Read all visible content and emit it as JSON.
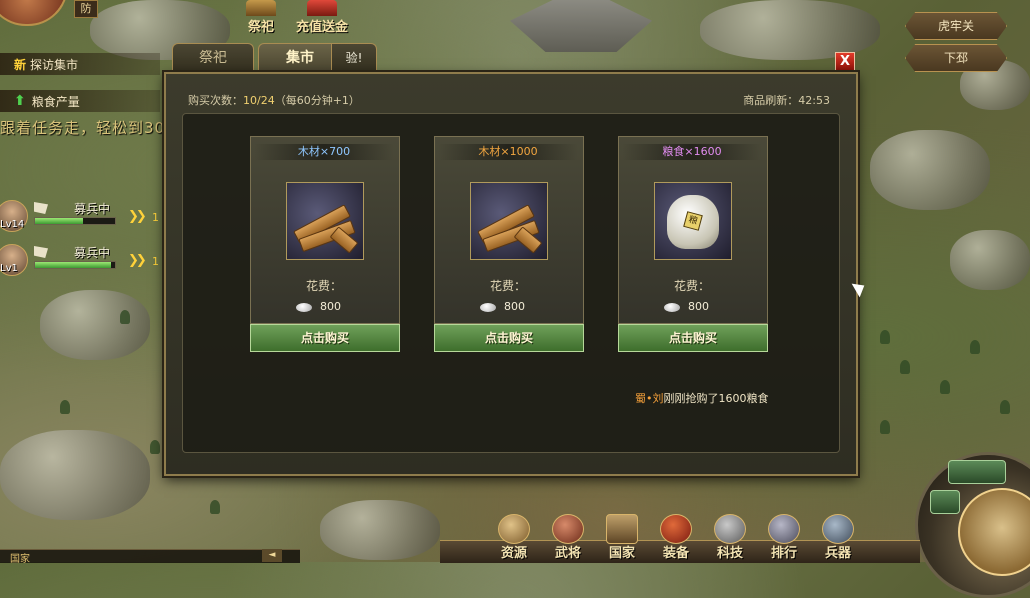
{
  "hud": {
    "fang_label": "防",
    "top_buttons": [
      {
        "label": "祭祀"
      },
      {
        "label": "充值送金"
      }
    ],
    "quests": [
      {
        "badge": "新",
        "label": "探访集市"
      },
      {
        "label": "粮食产量"
      }
    ],
    "scroll_text": "跟着任务走，轻松到30",
    "recruits": [
      {
        "level": "Lv14",
        "label": "募兵中",
        "progress": 0.6,
        "count": "1"
      },
      {
        "level": "Lv1",
        "label": "募兵中",
        "progress": 0.95,
        "count": "1"
      }
    ],
    "cities": [
      "虎牢关",
      "下邳"
    ]
  },
  "modal": {
    "tabs": [
      {
        "label": "祭祀"
      },
      {
        "label": "集市"
      },
      {
        "label": "验!"
      }
    ],
    "close_label": "X",
    "buy_count_label": "购买次数：",
    "buy_count_value": "10/24",
    "buy_count_note": "（每60分钟+1）",
    "refresh_label": "商品刷新：",
    "refresh_time": "42:53",
    "cost_label": "花费：",
    "buy_label": "点击购买",
    "items": [
      {
        "name": "木材×700",
        "name_color": "#8fc7ff",
        "price": "800",
        "icon": "wood-icon"
      },
      {
        "name": "木材×1000",
        "name_color": "#f2a640",
        "price": "800",
        "icon": "wood-icon"
      },
      {
        "name": "粮食×1600",
        "name_color": "#e18cf0",
        "price": "800",
        "icon": "grain-sack-icon",
        "tag": "粮"
      }
    ],
    "log": {
      "who": "蜀•刘",
      "text": "刚刚抢购了1600粮食"
    }
  },
  "bottom_nav": [
    {
      "label": "资源",
      "icon": "coin-icon"
    },
    {
      "label": "武将",
      "icon": "general-icon"
    },
    {
      "label": "国家",
      "icon": "scroll-icon"
    },
    {
      "label": "装备",
      "icon": "armor-icon"
    },
    {
      "label": "科技",
      "icon": "gear-icon"
    },
    {
      "label": "排行",
      "icon": "rank-icon"
    },
    {
      "label": "兵器",
      "icon": "weapon-icon"
    }
  ],
  "chat": {
    "channel": "国家",
    "close_label": "◄"
  }
}
